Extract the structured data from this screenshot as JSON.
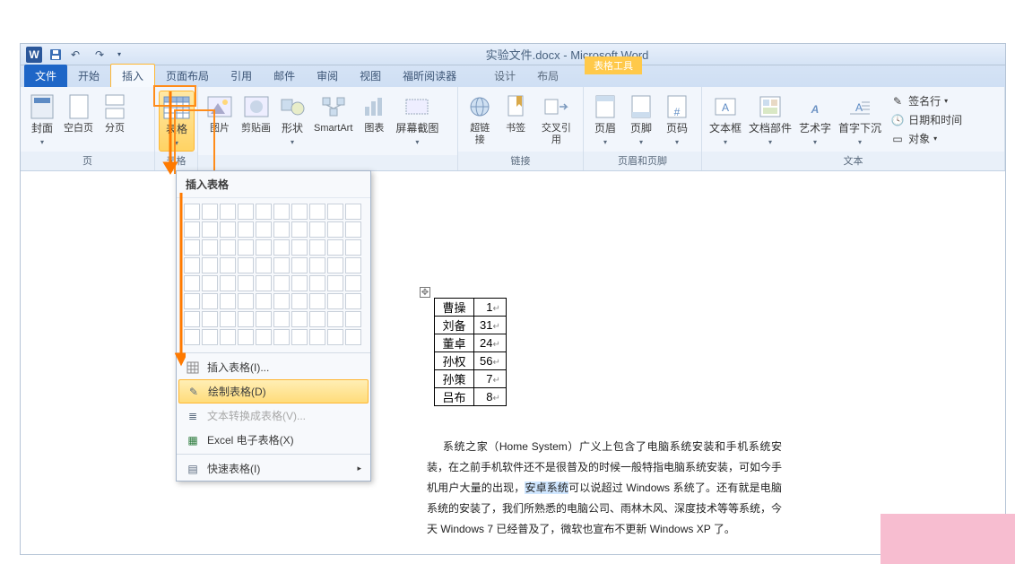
{
  "title": "实验文件.docx  -  Microsoft Word",
  "tabtools_label": "表格工具",
  "tabs": {
    "file": "文件",
    "home": "开始",
    "insert": "插入",
    "pagelayout": "页面布局",
    "references": "引用",
    "mailings": "邮件",
    "review": "审阅",
    "view": "视图",
    "foxit": "福昕阅读器",
    "design": "设计",
    "layout": "布局"
  },
  "groups": {
    "pages": "页",
    "tables": "表格",
    "links": "链接",
    "headerfooter": "页眉和页脚",
    "text": "文本"
  },
  "buttons": {
    "cover": "封面",
    "blank": "空白页",
    "pagebreak": "分页",
    "table": "表格",
    "picture": "图片",
    "clipart": "剪贴画",
    "shapes": "形状",
    "smartart": "SmartArt",
    "chart": "图表",
    "screenshot": "屏幕截图",
    "hyperlink": "超链接",
    "bookmark": "书签",
    "crossref": "交叉引用",
    "header": "页眉",
    "footer": "页脚",
    "pagenum": "页码",
    "textbox": "文本框",
    "quickparts": "文档部件",
    "wordart": "艺术字",
    "dropcap": "首字下沉",
    "signature": "签名行",
    "datetime": "日期和时间",
    "object": "对象"
  },
  "dropdown": {
    "header": "插入表格",
    "insert": "插入表格(I)...",
    "draw": "绘制表格(D)",
    "convert": "文本转换成表格(V)...",
    "excel": "Excel 电子表格(X)",
    "quick": "快速表格(I)"
  },
  "doc_table": [
    {
      "name": "曹操",
      "val": "1"
    },
    {
      "name": "刘备",
      "val": "31"
    },
    {
      "name": "董卓",
      "val": "24"
    },
    {
      "name": "孙权",
      "val": "56"
    },
    {
      "name": "孙策",
      "val": "7"
    },
    {
      "name": "吕布",
      "val": "8"
    }
  ],
  "paragraph_prefix": "系统之家（Home System）广义上包含了电脑系统安装和手机系统安装，在之前手机软件还不是很普及的时候一般特指电脑系统安装，可如今手机用户大量的出现，",
  "paragraph_hl": "安卓系统",
  "paragraph_suffix": "可以说超过 Windows 系统了。还有就是电脑系统的安装了，我们所熟悉的电脑公司、雨林木风、深度技术等等系统，今天 Windows 7 已经普及了，微软也宣布不更新 Windows XP 了。"
}
